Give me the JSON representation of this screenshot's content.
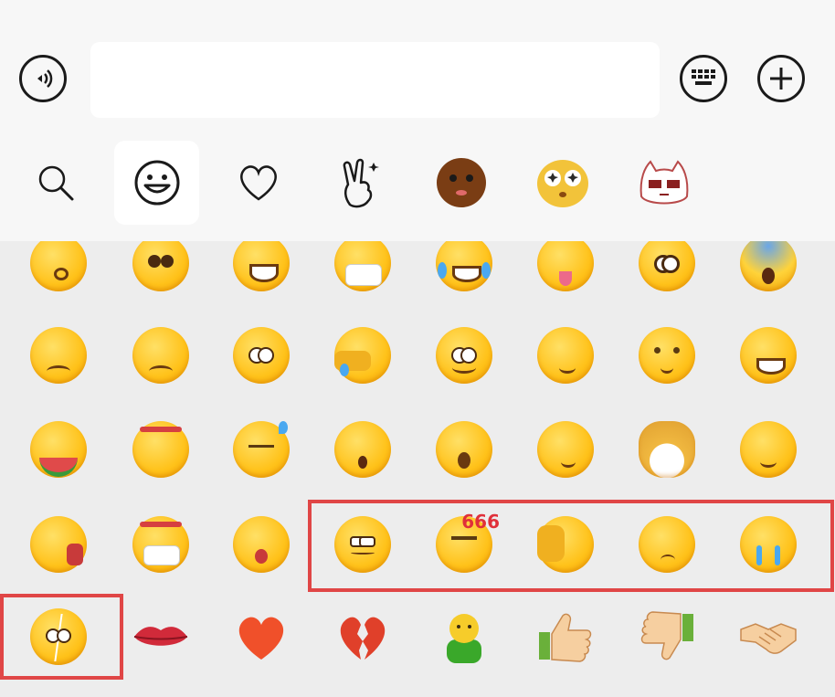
{
  "input_bar": {
    "text_value": "",
    "icons": [
      "voice-icon",
      "keyboard-icon",
      "plus-icon"
    ]
  },
  "tabs": [
    {
      "name": "search",
      "icon": "search-icon",
      "active": false
    },
    {
      "name": "smiley",
      "icon": "smiley-icon",
      "active": true
    },
    {
      "name": "favorites",
      "icon": "heart-icon",
      "active": false
    },
    {
      "name": "gestures",
      "icon": "victory-hand-icon",
      "active": false
    },
    {
      "name": "sticker-pack-1",
      "icon": "brown-face-sticker",
      "active": false
    },
    {
      "name": "sticker-pack-2",
      "icon": "starry-eyes-sticker",
      "active": false
    },
    {
      "name": "sticker-pack-3",
      "icon": "cat-sticker",
      "active": false
    }
  ],
  "emoji_rows": [
    [
      "kissing-closed-eyes",
      "pleading-hands",
      "grinning",
      "mask-smile",
      "tears-of-joy",
      "squinting-tongue",
      "flushed",
      "scream"
    ],
    [
      "pensive",
      "unamused",
      "smirk-hand",
      "facepalm",
      "side-eye-smile",
      "smirk-chin",
      "shy-smile",
      "peace-grin"
    ],
    [
      "watermelon-eating",
      "headband-thumb",
      "sweat-expressionless",
      "shocked-pop",
      "yawning",
      "thinking-smirk",
      "doge",
      "ok-smirk"
    ],
    [
      "hand-mouth-awe",
      "mask-thumbs",
      "star-struck",
      "blank-stare",
      "666-thumbs",
      "hand-peek",
      "sigh",
      "tearful"
    ],
    [
      "cracked-face",
      "lips",
      "red-heart",
      "broken-heart",
      "green-figure",
      "thumbs-up",
      "thumbs-down",
      "handshake"
    ]
  ],
  "badges": {
    "six_six_six": "666"
  },
  "highlight_color": "#e04646"
}
